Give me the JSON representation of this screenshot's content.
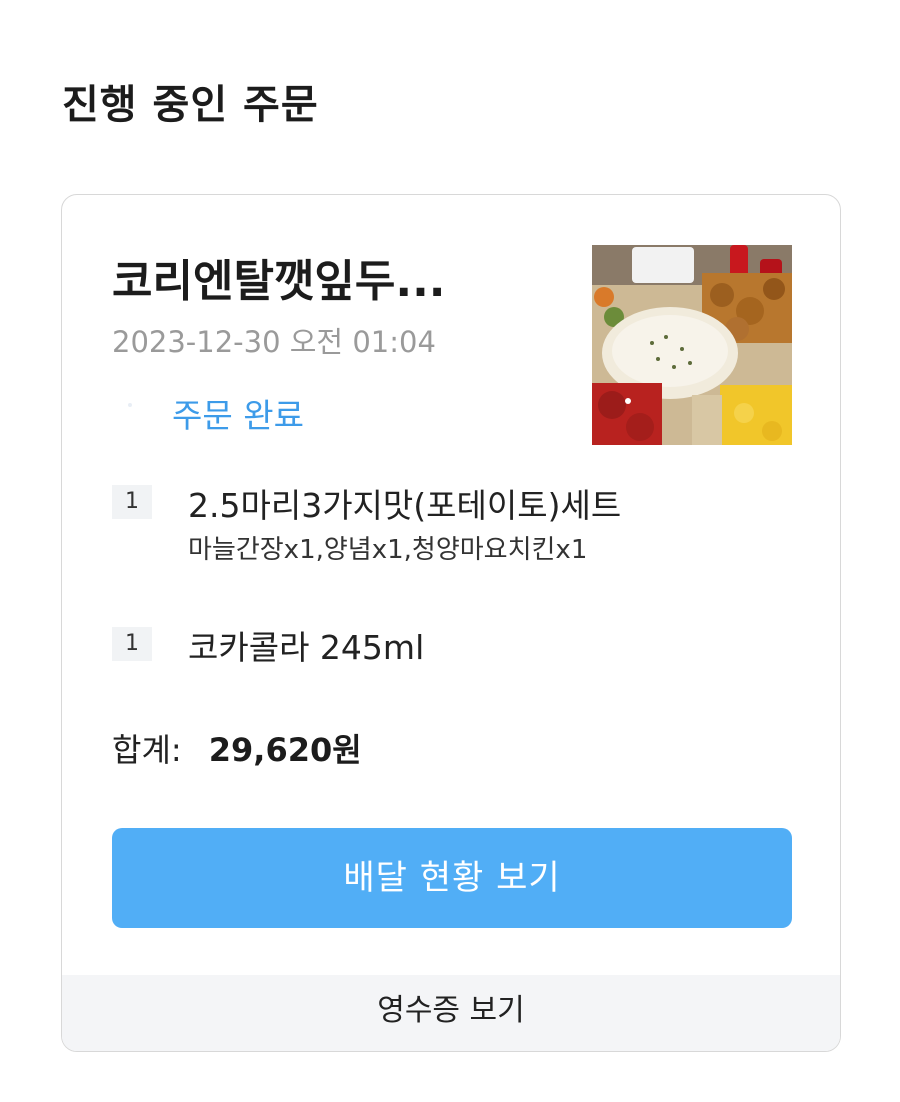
{
  "section": {
    "title": "진행 중인 주문"
  },
  "order": {
    "store_name": "코리엔탈깻잎두...",
    "date": "2023-12-30 오전 01:04",
    "status": "주문 완료",
    "status_color": "#3d9be9",
    "image_icon": "chicken-set-photo",
    "items": [
      {
        "qty": "1",
        "name": "2.5마리3가지맛(포테이토)세트",
        "options": "마늘간장x1,양념x1,청양마요치킨x1"
      },
      {
        "qty": "1",
        "name": "코카콜라 245ml",
        "options": ""
      }
    ],
    "total_label": "합계:",
    "total_value": "29,620원"
  },
  "actions": {
    "track_label": "배달 현황 보기",
    "track_color": "#51aef6",
    "receipt_label": "영수증 보기"
  }
}
